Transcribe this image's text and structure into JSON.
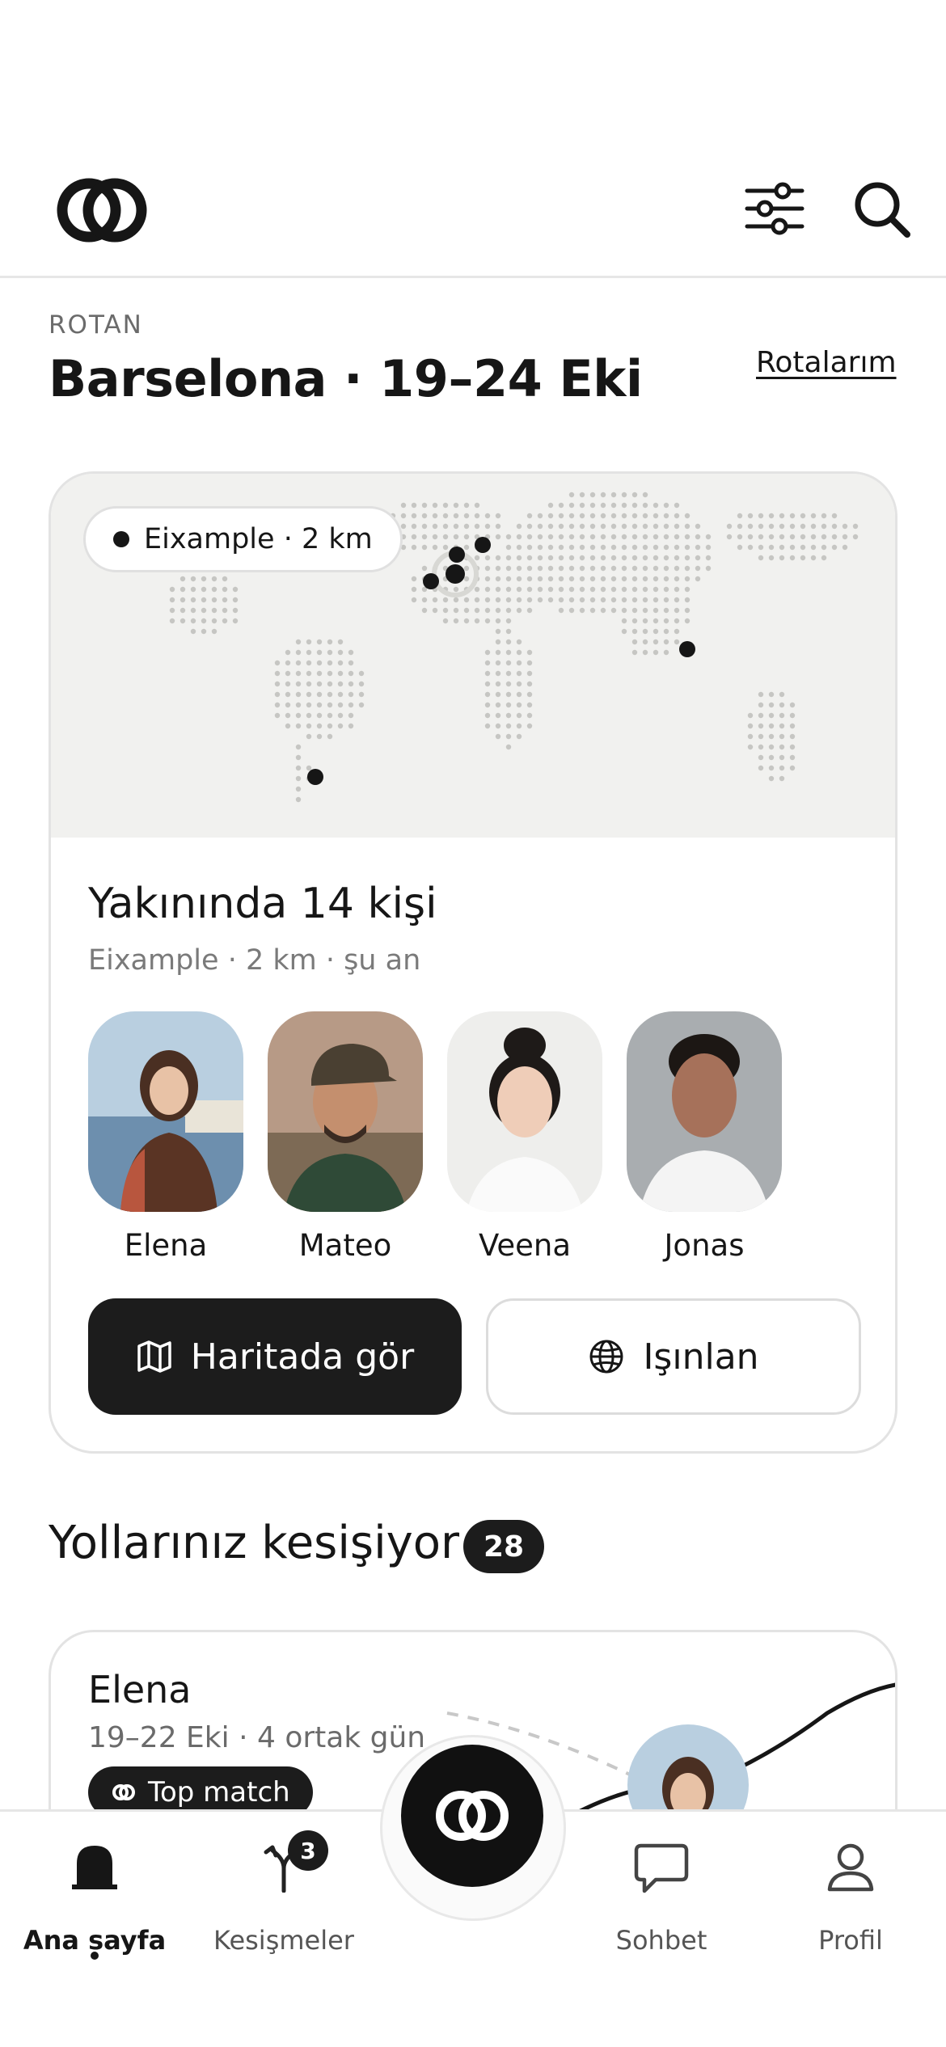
{
  "header": {
    "logo_icon": "two-rings-logo-icon",
    "filter_icon": "sliders-icon",
    "search_icon": "search-icon"
  },
  "route": {
    "label": "ROTAN",
    "title": "Barselona · 19–24 Eki",
    "link": "Rotalarım"
  },
  "nearby": {
    "location_pill": "Eixample · 2 km",
    "title": "Yakınında 14 kişi",
    "subtitle": "Eixample · 2 km · şu an",
    "people": [
      {
        "name": "Elena"
      },
      {
        "name": "Mateo"
      },
      {
        "name": "Veena"
      },
      {
        "name": "Jonas"
      }
    ],
    "map_button": "Haritada gör",
    "teleport_button": "Işınlan"
  },
  "crossings": {
    "title": "Yollarınız kesişiyor",
    "count": "28",
    "card": {
      "name": "Elena",
      "subtitle": "19–22 Eki · 4 ortak gün",
      "badge": "Top match"
    }
  },
  "nav": {
    "home": "Ana sayfa",
    "crossings": "Kesişmeler",
    "crossings_badge": "3",
    "chat": "Sohbet",
    "profile": "Profil"
  },
  "colors": {
    "primary": "#1c1c1c",
    "map_bg": "#f1f1ef",
    "muted_text": "#7a7a7a"
  }
}
